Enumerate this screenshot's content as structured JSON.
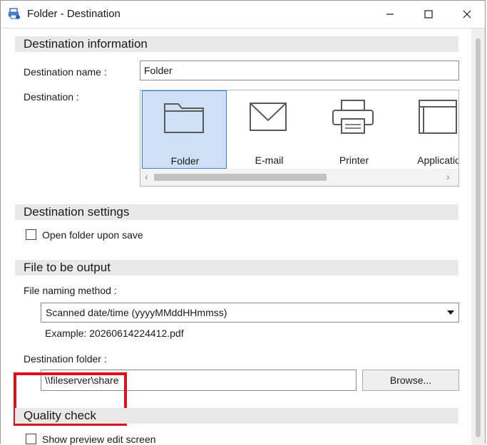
{
  "window": {
    "title": "Folder - Destination"
  },
  "sections": {
    "destination_information": "Destination information",
    "destination_settings": "Destination settings",
    "file_to_be_output": "File to be output",
    "quality_check": "Quality check"
  },
  "destination_information": {
    "name_label": "Destination name :",
    "name_value": "Folder",
    "destination_label": "Destination :",
    "tiles": [
      {
        "label": "Folder",
        "icon": "folder-icon",
        "selected": true
      },
      {
        "label": "E-mail",
        "icon": "envelope-icon",
        "selected": false
      },
      {
        "label": "Printer",
        "icon": "printer-icon",
        "selected": false
      },
      {
        "label": "Applicatio",
        "icon": "application-window-icon",
        "selected": false
      }
    ]
  },
  "destination_settings": {
    "open_folder_label": "Open folder upon save",
    "open_folder_checked": false
  },
  "file_to_be_output": {
    "naming_label": "File naming method :",
    "naming_value": "Scanned date/time (yyyyMMddHHmmss)",
    "example": "Example: 20260614224412.pdf",
    "folder_label": "Destination folder :",
    "folder_value": "\\\\fileserver\\share",
    "browse_label": "Browse..."
  },
  "quality_check": {
    "preview_label": "Show preview edit screen",
    "preview_checked": false
  },
  "colors": {
    "accent": "#3f7fd1",
    "selected_tile": "#cfe0f4",
    "section_header_bg": "#e9e9e9",
    "highlight_red": "#e0101a"
  }
}
